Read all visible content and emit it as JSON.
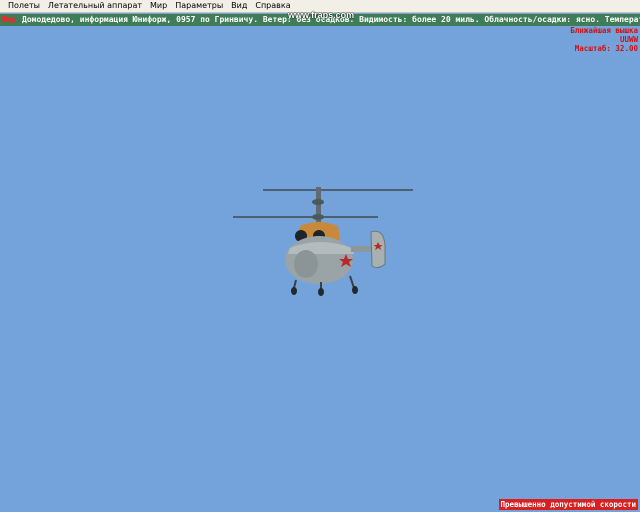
{
  "menu": {
    "items": [
      "Полеты",
      "Летательный аппарат",
      "Мир",
      "Параметры",
      "Вид",
      "Справка"
    ]
  },
  "atis": {
    "prefix": "Шер",
    "text": "Домодедово, информация Юнифорж, 0957 по Гринвичу. Ветер: без осадков. Видимость: более 20 миль. Облачность/осадки: ясно. Температ"
  },
  "watermark": "www.fraps.com",
  "nearest_tower": {
    "title": "Ближайшая вышка",
    "code": "UUWW",
    "scale": "Масштаб: 32.00"
  },
  "warning": "Превышенно допустимой скорости",
  "colors": {
    "sky": "#74a3dc",
    "atis_bar": "#3e7d58",
    "warning_bg": "#d82020",
    "hud_text": "#d41010"
  },
  "scene": {
    "object": "helicopter-icon"
  }
}
